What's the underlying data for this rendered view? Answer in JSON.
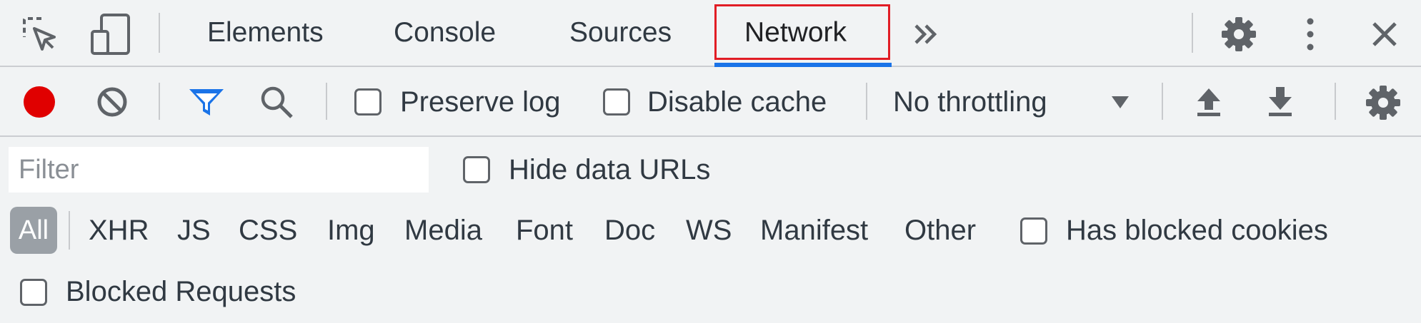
{
  "tabbar": {
    "tabs": [
      {
        "label": "Elements"
      },
      {
        "label": "Console"
      },
      {
        "label": "Sources"
      },
      {
        "label": "Network"
      }
    ],
    "active_tab": "Network",
    "more_tabs_icon": "chevron-double-right-icon",
    "inspect_icon": "inspect-element-icon",
    "device_icon": "device-toolbar-icon",
    "settings_icon": "gear-icon",
    "menu_icon": "kebab-menu-icon",
    "close_icon": "close-icon"
  },
  "toolbar": {
    "record_icon": "record-icon",
    "clear_icon": "clear-icon",
    "filter_icon": "filter-icon",
    "search_icon": "search-icon",
    "preserve_log_label": "Preserve log",
    "preserve_log_checked": false,
    "disable_cache_label": "Disable cache",
    "disable_cache_checked": false,
    "throttling_value": "No throttling",
    "upload_icon": "upload-icon",
    "download_icon": "download-icon",
    "settings_icon": "gear-icon"
  },
  "filterbar": {
    "filter_placeholder": "Filter",
    "filter_value": "",
    "hide_data_urls_label": "Hide data URLs",
    "hide_data_urls_checked": false
  },
  "types": {
    "all_label": "All",
    "items": [
      "XHR",
      "JS",
      "CSS",
      "Img",
      "Media",
      "Font",
      "Doc",
      "WS",
      "Manifest",
      "Other"
    ],
    "has_blocked_cookies_label": "Has blocked cookies",
    "has_blocked_cookies_checked": false
  },
  "blocked_requests_label": "Blocked Requests",
  "blocked_requests_checked": false,
  "colors": {
    "record": "#e00000",
    "filter_active": "#1a73e8",
    "highlight_box": "#e11d25",
    "all_button_bg": "#9aa0a6"
  }
}
